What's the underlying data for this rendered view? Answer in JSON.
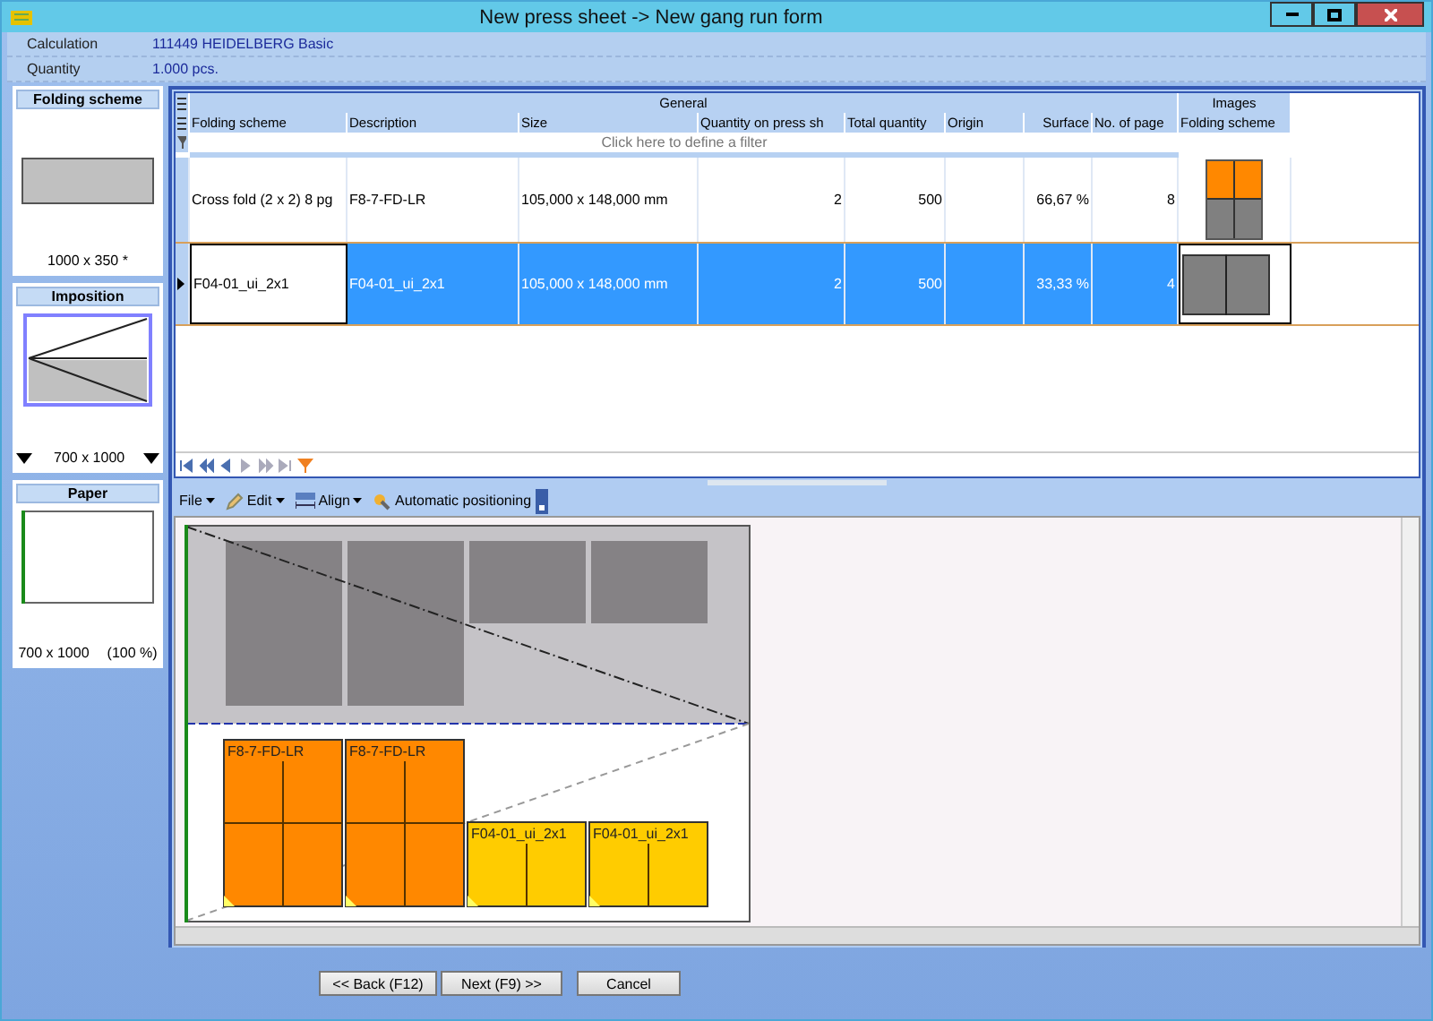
{
  "window": {
    "title": "New press sheet -> New gang run form"
  },
  "info": [
    {
      "label": "Calculation",
      "value": "111449 HEIDELBERG Basic"
    },
    {
      "label": "Quantity",
      "value": "1.000 pcs."
    }
  ],
  "sidebar": [
    {
      "kind": "folding",
      "title": "Folding scheme",
      "caption": "1000 x 350 *"
    },
    {
      "kind": "imposition",
      "title": "Imposition",
      "caption": "700 x 1000"
    },
    {
      "kind": "paper",
      "title": "Paper",
      "caption": "700 x 1000",
      "extra": "(100 %)"
    }
  ],
  "grid": {
    "groups": [
      "General",
      "Images"
    ],
    "columns": [
      "Folding scheme",
      "Description",
      "Size",
      "Quantity on press sh",
      "Total quantity",
      "Origin",
      "Surface",
      "No. of page",
      "Folding scheme"
    ],
    "filter_placeholder": "Click here to define a filter",
    "rows": [
      {
        "selected": false,
        "cells": [
          "Cross fold (2 x 2)  8 pg",
          "F8-7-FD-LR",
          "105,000 x  148,000 mm",
          "2",
          "500",
          "",
          "66,67 %",
          "8"
        ]
      },
      {
        "selected": true,
        "cells": [
          "F04-01_ui_2x1",
          "F04-01_ui_2x1",
          "105,000 x  148,000 mm",
          "2",
          "500",
          "",
          "33,33 %",
          "4"
        ]
      }
    ]
  },
  "toolbar": [
    "File",
    "Edit",
    "Align",
    "Automatic positioning"
  ],
  "canvas": {
    "tiles": [
      {
        "kind": "orange",
        "label": "F8-7-FD-LR"
      },
      {
        "kind": "orange",
        "label": "F8-7-FD-LR"
      },
      {
        "kind": "yellow",
        "label": "F04-01_ui_2x1"
      },
      {
        "kind": "yellow",
        "label": "F04-01_ui_2x1"
      }
    ]
  },
  "buttons": [
    "<< Back (F12)",
    "Next (F9) >>",
    "Cancel"
  ]
}
